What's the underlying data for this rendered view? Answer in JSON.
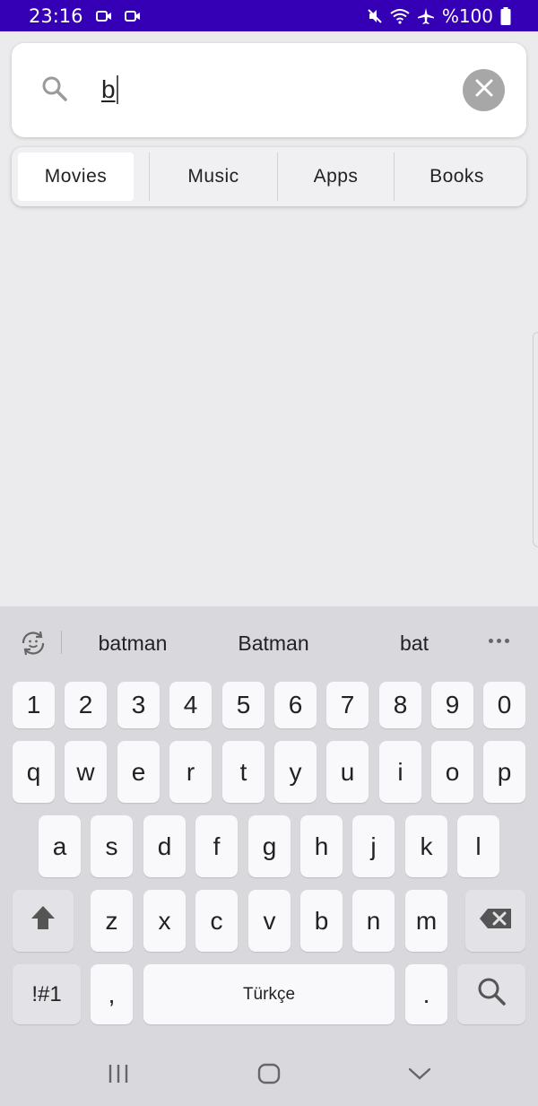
{
  "status_bar": {
    "time": "23:16",
    "left_icons": [
      "video-camera-icon",
      "video-camera-icon"
    ],
    "right_icons": [
      "mute-icon",
      "wifi-icon",
      "airplane-icon"
    ],
    "battery_text": "%100",
    "battery_icon": "battery-icon",
    "background": "#3500b5"
  },
  "search": {
    "value": "b",
    "icon": "search-icon",
    "clear_icon": "close-icon"
  },
  "tabs": [
    {
      "label": "Movies",
      "active": true
    },
    {
      "label": "Music",
      "active": false
    },
    {
      "label": "Apps",
      "active": false
    },
    {
      "label": "Books",
      "active": false
    }
  ],
  "keyboard": {
    "suggestions": [
      "batman",
      "Batman",
      "bat"
    ],
    "number_row": [
      "1",
      "2",
      "3",
      "4",
      "5",
      "6",
      "7",
      "8",
      "9",
      "0"
    ],
    "row1": [
      "q",
      "w",
      "e",
      "r",
      "t",
      "y",
      "u",
      "i",
      "o",
      "p"
    ],
    "row2": [
      "a",
      "s",
      "d",
      "f",
      "g",
      "h",
      "j",
      "k",
      "l"
    ],
    "row3": [
      "z",
      "x",
      "c",
      "v",
      "b",
      "n",
      "m"
    ],
    "symbols_label": "!#1",
    "comma_label": ",",
    "space_label": "Türkçe",
    "period_label": ".",
    "shift_icon": "shift-arrow-icon",
    "backspace_icon": "backspace-icon",
    "search_key_icon": "search-icon"
  },
  "nav_bar": {
    "icons": [
      "recent-apps-icon",
      "home-icon",
      "back-icon"
    ]
  }
}
